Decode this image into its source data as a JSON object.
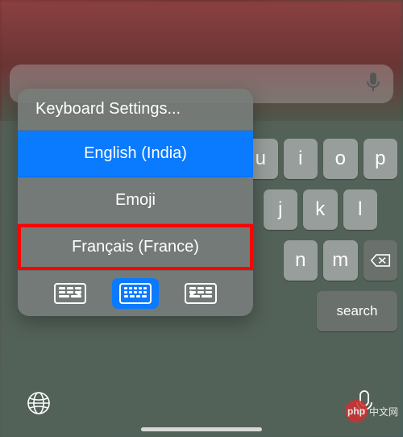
{
  "popup": {
    "settingsLabel": "Keyboard Settings...",
    "languages": [
      {
        "label": "English (India)",
        "selected": true
      },
      {
        "label": "Emoji",
        "selected": false
      },
      {
        "label": "Français (France)",
        "selected": false,
        "highlighted": true
      }
    ],
    "layoutOptions": [
      "left-handed",
      "full",
      "right-handed"
    ],
    "selectedLayout": "full"
  },
  "keyboard": {
    "row1": [
      "u",
      "i",
      "o",
      "p"
    ],
    "row2": [
      "j",
      "k",
      "l"
    ],
    "row3": [
      "n",
      "m"
    ],
    "searchLabel": "search"
  },
  "watermark": {
    "badge": "php",
    "text": "中文网"
  }
}
